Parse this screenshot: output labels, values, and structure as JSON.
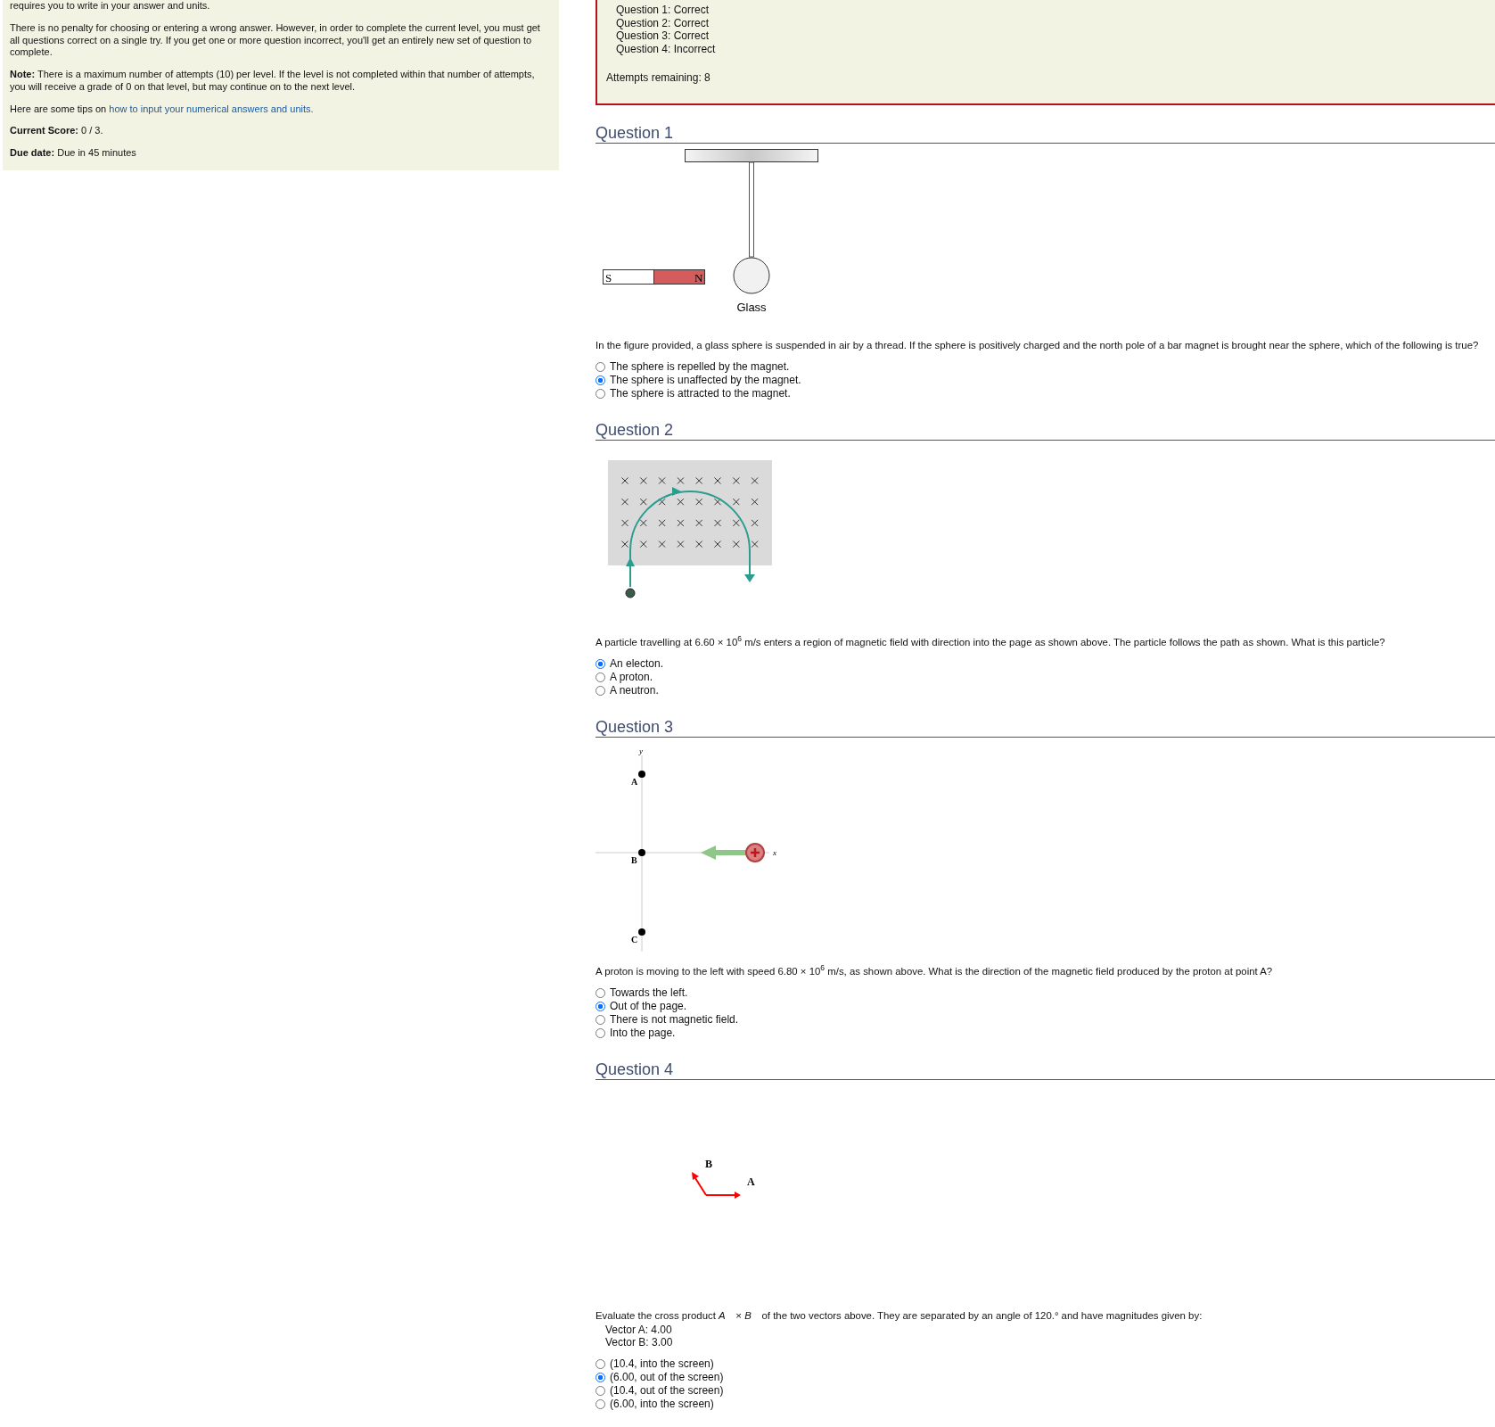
{
  "instructions": {
    "paragraphs": [
      "requires you to write in your answer and units.",
      "There is no penalty for choosing or entering a wrong answer. However, in order to complete the current level, you must get all questions correct on a single try. If you get one or more question incorrect, you'll get an entirely new set of question to complete.",
      "**Note:** There is a maximum number of attempts (10) per level. If the level is not completed within that number of attempts, you will receive a grade of 0 on that level, but may continue on to the next level."
    ],
    "tips_prefix": "Here are some tips on",
    "tips_link": "how to input your numerical answers and units.",
    "score_label": "Current Score:",
    "score": "0 / 3.",
    "due_label": "Due date:",
    "due": "Due in 45 minutes"
  },
  "feedback": {
    "results": [
      "Question 1: Correct",
      "Question 2: Correct",
      "Question 3: Correct",
      "Question 4: Incorrect"
    ],
    "attempts": "Attempts remaining: 8"
  },
  "questions": [
    {
      "title": "Question 1",
      "kind": "pendulum",
      "labels": [
        "S",
        "N",
        "Glass"
      ],
      "text": "In the figure provided, a glass sphere is suspended in air by a thread. If the sphere is positively charged and the north pole of a bar magnet is brought near the sphere, which of the following is true?",
      "options": [
        {
          "label": "The sphere is repelled by the magnet.",
          "selected": false
        },
        {
          "label": "The sphere is unaffected by the magnet.",
          "selected": true
        },
        {
          "label": "The sphere is attracted to the magnet.",
          "selected": false
        }
      ]
    },
    {
      "title": "Question 2",
      "kind": "field",
      "text": "A particle travelling at 6.60 × 10$^{6}$ m/s enters a region of magnetic field with direction into the page as shown above. The particle follows the path as shown. What is this particle?",
      "options": [
        {
          "label": "An electon.",
          "selected": true
        },
        {
          "label": "A proton.",
          "selected": false
        },
        {
          "label": "A neutron.",
          "selected": false
        }
      ]
    },
    {
      "title": "Question 3",
      "kind": "axes",
      "labels": [
        "y",
        "A",
        "B",
        "C",
        "x"
      ],
      "text": "A proton is moving to the left with speed 6.80 × 10$^{6}$ m/s, as shown above. What is the direction of the magnetic field produced by the proton at point A?",
      "options": [
        {
          "label": "Towards the left.",
          "selected": false
        },
        {
          "label": "Out of the page.",
          "selected": true
        },
        {
          "label": "There is not magnetic field.",
          "selected": false
        },
        {
          "label": "Into the page.",
          "selected": false
        }
      ]
    },
    {
      "title": "Question 4",
      "kind": "vectors",
      "labels": [
        "B",
        "A"
      ],
      "text": "Evaluate the cross product *A⃗* × *B⃗* of the two vectors above. They are separated by an angle of 120.° and have magnitudes given by:",
      "details": [
        "Vector A: 4.00",
        "Vector B: 3.00"
      ],
      "options": [
        {
          "label": "(10.4, into the screen)",
          "selected": false
        },
        {
          "label": "(6.00, out of the screen)",
          "selected": true
        },
        {
          "label": "(10.4, out of the screen)",
          "selected": false
        },
        {
          "label": "(6.00, into the screen)",
          "selected": false
        }
      ]
    }
  ]
}
